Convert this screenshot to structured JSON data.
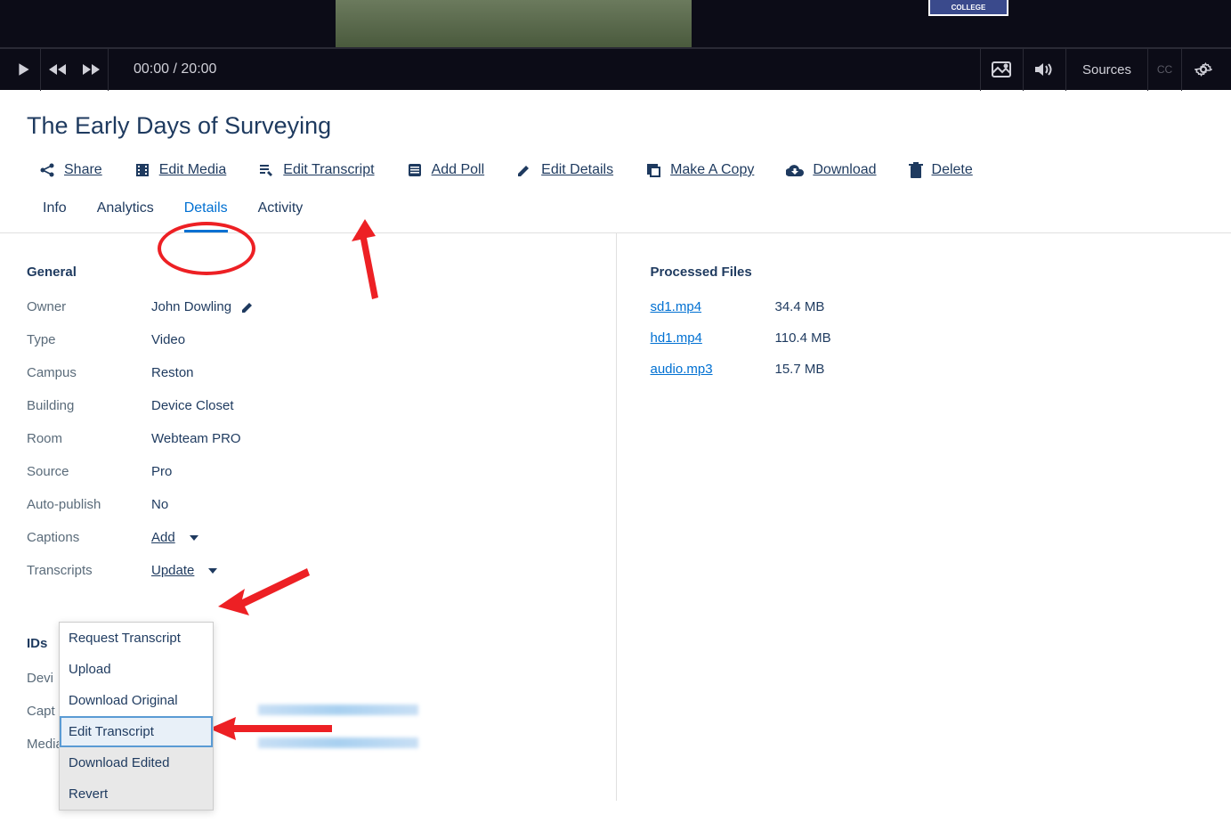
{
  "video_badge": "COLLEGE",
  "player": {
    "time_current": "00:00",
    "time_total": "20:00",
    "sources_label": "Sources",
    "cc_label": "CC"
  },
  "title": "The Early Days of Surveying",
  "toolbar": {
    "share": "Share",
    "edit_media": "Edit Media",
    "edit_transcript": "Edit Transcript",
    "add_poll": "Add Poll",
    "edit_details": "Edit Details",
    "make_copy": "Make A Copy",
    "download": "Download",
    "delete": "Delete"
  },
  "tabs": {
    "info": "Info",
    "analytics": "Analytics",
    "details": "Details",
    "activity": "Activity"
  },
  "details": {
    "general_header": "General",
    "owner_label": "Owner",
    "owner_value": "John Dowling",
    "type_label": "Type",
    "type_value": "Video",
    "campus_label": "Campus",
    "campus_value": "Reston",
    "building_label": "Building",
    "building_value": "Device Closet",
    "room_label": "Room",
    "room_value": "Webteam PRO",
    "source_label": "Source",
    "source_value": "Pro",
    "auto_publish_label": "Auto-publish",
    "auto_publish_value": "No",
    "captions_label": "Captions",
    "captions_value": "Add",
    "transcripts_label": "Transcripts",
    "transcripts_value": "Update"
  },
  "ids": {
    "header": "IDs",
    "device_label": "Devi",
    "capture_label": "Capt",
    "media_label": "Media"
  },
  "files": {
    "header": "Processed Files",
    "rows": [
      {
        "name": "sd1.mp4",
        "size": "34.4 MB"
      },
      {
        "name": "hd1.mp4",
        "size": "110.4 MB"
      },
      {
        "name": "audio.mp3",
        "size": "15.7 MB"
      }
    ]
  },
  "dropdown": {
    "request": "Request Transcript",
    "upload": "Upload",
    "download_original": "Download Original",
    "edit_transcript": "Edit Transcript",
    "download_edited": "Download Edited",
    "revert": "Revert"
  }
}
